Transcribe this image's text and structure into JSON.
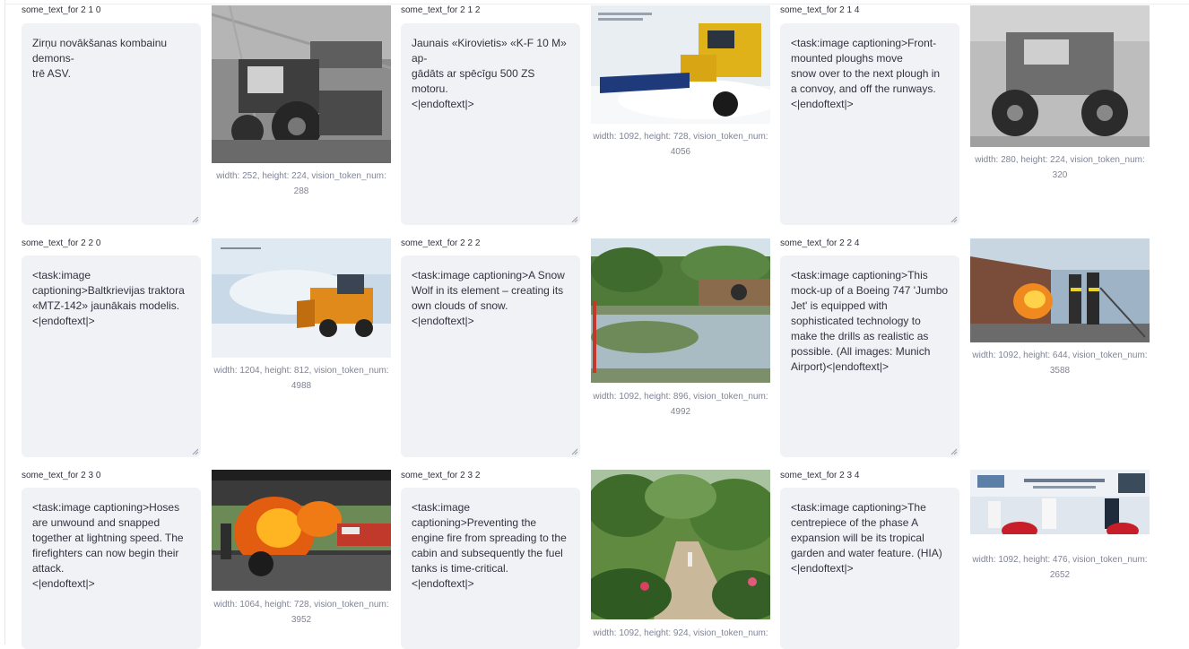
{
  "rows": [
    {
      "cells": [
        {
          "label": "some_text_for 2 1 0",
          "text": "Zirņu novākšanas kombainu demons-\ntrē ASV.",
          "image_icon": "tractor-bw-photo",
          "caption": "width: 252, height: 224, vision_token_num: 288"
        },
        {
          "label": "some_text_for 2 1 2",
          "text": "Jaunais «Kirovietis» «K-F 10 M» ap-\ngādāts ar spēcīgu 500 ZS motoru.\n<|endoftext|>",
          "image_icon": "snowplow-photo",
          "caption": "width: 1092, height: 728, vision_token_num: 4056"
        },
        {
          "label": "some_text_for 2 1 4",
          "text": "<task:image captioning>Front-mounted ploughs move\nsnow over to the next plough in a convoy, and off the runways.\n<|endoftext|>",
          "image_icon": "tractor-bw-photo",
          "caption": "width: 280, height: 224, vision_token_num: 320"
        }
      ]
    },
    {
      "cells": [
        {
          "label": "some_text_for 2 2 0",
          "text": "<task:image captioning>Baltkrievijas traktora «MTZ-142» jaunākais modelis.\n<|endoftext|>",
          "image_icon": "snow-blower-photo",
          "caption": "width: 1204, height: 812, vision_token_num: 4988"
        },
        {
          "label": "some_text_for 2 2 2",
          "text": "<task:image captioning>A Snow Wolf in its element – creating its own clouds of snow.<|endoftext|>",
          "image_icon": "lake-reflection-photo",
          "caption": "width: 1092, height: 896, vision_token_num: 4992"
        },
        {
          "label": "some_text_for 2 2 4",
          "text": "<task:image captioning>This mock-up of a Boeing 747 'Jumbo Jet' is equipped with sophisticated technology to make the drills as realistic as possible. (All images: Munich Airport)<|endoftext|>",
          "image_icon": "firefighters-photo",
          "caption": "width: 1092, height: 644, vision_token_num: 3588"
        }
      ]
    },
    {
      "cells": [
        {
          "label": "some_text_for 2 3 0",
          "text": "<task:image captioning>Hoses are unwound and snapped together at lightning speed. The firefighters can now begin their attack.\n<|endoftext|>",
          "image_icon": "fire-drill-photo",
          "caption": "width: 1064, height: 728, vision_token_num: 3952"
        },
        {
          "label": "some_text_for 2 3 2",
          "text": "<task:image captioning>Preventing the engine fire from spreading to the cabin and subsequently the fuel tanks is time-critical.<|endoftext|>",
          "image_icon": "tropical-garden-photo",
          "caption": "width: 1092, height: 924, vision_token_num:"
        },
        {
          "label": "some_text_for 2 3 4",
          "text": "<task:image captioning>The centrepiece of the phase A expansion will be its tropical garden and water feature. (HIA)\n<|endoftext|>",
          "image_icon": "press-conference-photo",
          "caption": "width: 1092, height: 476, vision_token_num: 2652"
        }
      ]
    }
  ],
  "colors": {
    "textbox_bg": "#f0f2f6",
    "caption_text": "#808495",
    "body_text": "#31333f"
  }
}
